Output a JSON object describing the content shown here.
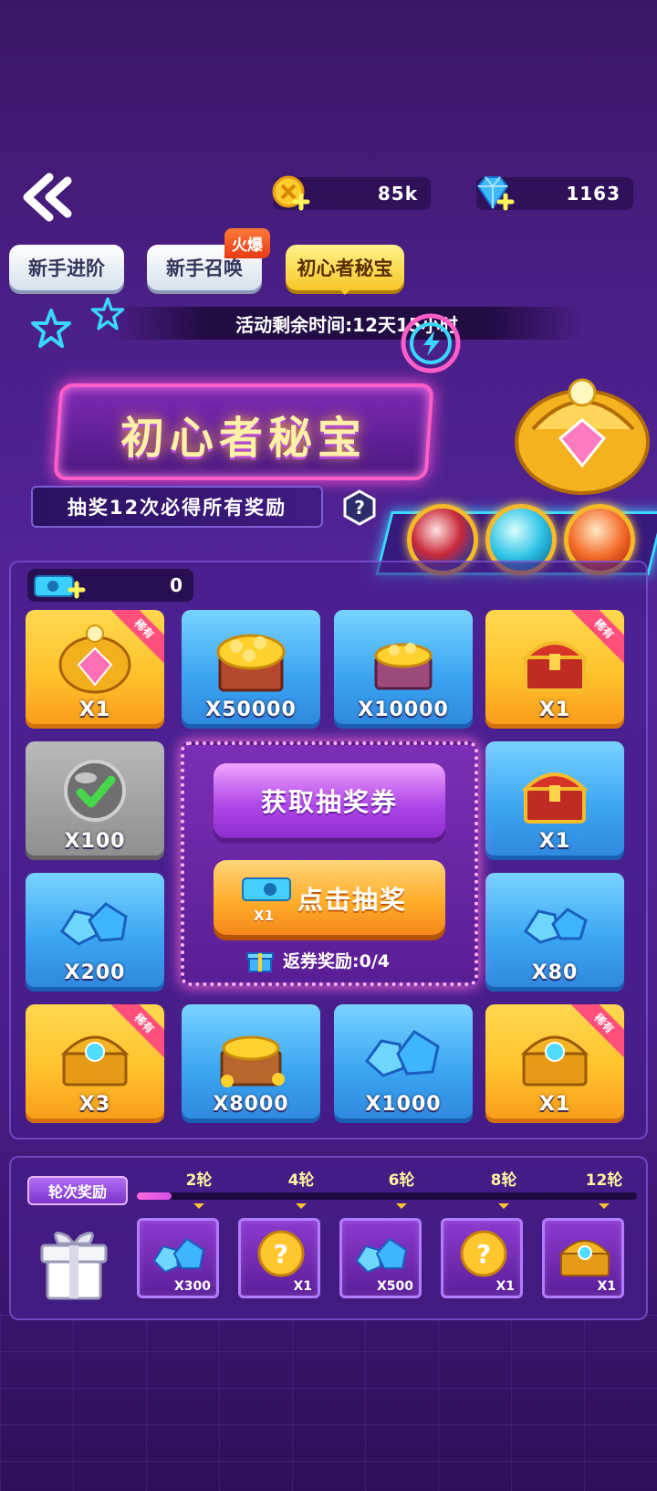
{
  "header": {
    "coin_value": "85k",
    "gem_value": "1163"
  },
  "tabs": [
    {
      "label": "新手进阶"
    },
    {
      "label": "新手召唤",
      "badge": "火爆"
    },
    {
      "label": "初心者秘宝",
      "active": true
    }
  ],
  "timer": "活动剩余时间:12天15小时",
  "banner": {
    "title": "初心者秘宝",
    "subtitle": "抽奖12次必得所有奖励",
    "help": "?"
  },
  "tickets": {
    "count": "0"
  },
  "rare_tag": "稀有",
  "grid": [
    {
      "type": "gold",
      "item": "golden-chest-icon",
      "qty": "X1",
      "rare": true
    },
    {
      "type": "blue",
      "item": "coin-chest-icon",
      "qty": "X50000"
    },
    {
      "type": "blue",
      "item": "coin-chest-small-icon",
      "qty": "X10000"
    },
    {
      "type": "gold",
      "item": "red-chest-icon",
      "qty": "X1",
      "rare": true
    },
    {
      "type": "gray",
      "item": "check-orb-icon",
      "qty": "X100"
    },
    {
      "type": "blue",
      "item": "red-chest-icon",
      "qty": "X1"
    },
    {
      "type": "blue",
      "item": "gems-icon",
      "qty": "X200"
    },
    {
      "type": "blue",
      "item": "gems-icon",
      "qty": "X80"
    },
    {
      "type": "gold",
      "item": "jeweled-chest-icon",
      "qty": "X3",
      "rare": true
    },
    {
      "type": "blue",
      "item": "coin-crate-icon",
      "qty": "X8000"
    },
    {
      "type": "blue",
      "item": "gems-icon",
      "qty": "X1000"
    },
    {
      "type": "gold",
      "item": "jeweled-chest-icon",
      "qty": "X1",
      "rare": true
    }
  ],
  "center": {
    "get_tickets": "获取抽奖券",
    "draw": "点击抽奖",
    "draw_cost": "X1",
    "return_reward": "返券奖励:0/4"
  },
  "rounds": {
    "label": "轮次奖励",
    "progress": 0.07,
    "milestones": [
      {
        "label": "2轮",
        "item": "gems-icon",
        "qty": "X300"
      },
      {
        "label": "4轮",
        "item": "mystery-coin-icon",
        "qty": "X1"
      },
      {
        "label": "6轮",
        "item": "gems-icon",
        "qty": "X500"
      },
      {
        "label": "8轮",
        "item": "mystery-coin-icon",
        "qty": "X1"
      },
      {
        "label": "12轮",
        "item": "jeweled-chest-icon",
        "qty": "X1"
      }
    ]
  },
  "colors": {
    "accent_gold": "#ffc22c",
    "accent_blue": "#3ba6f2",
    "neon_pink": "#ff5ec8",
    "neon_cyan": "#3ad8ff"
  }
}
